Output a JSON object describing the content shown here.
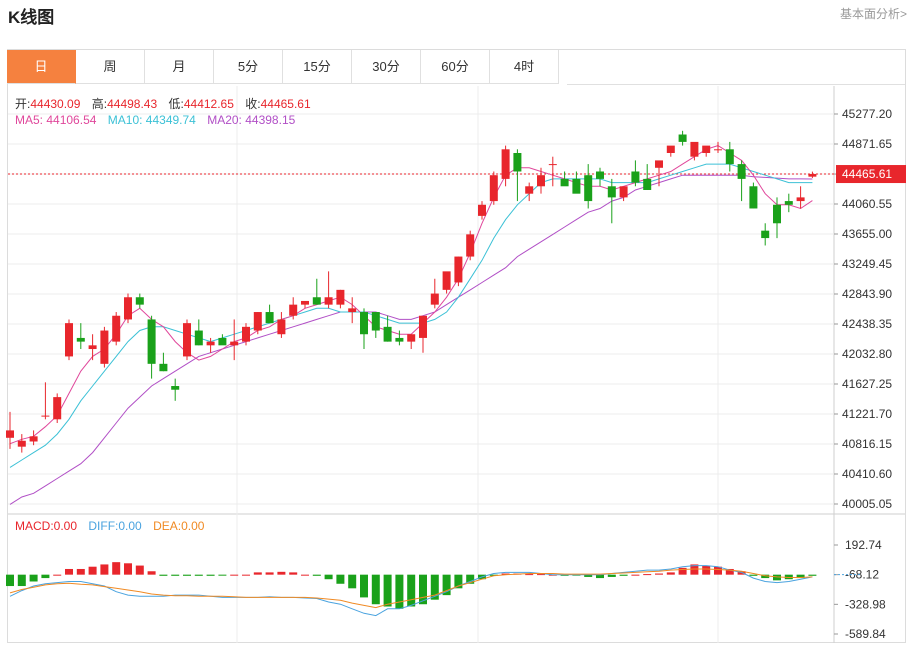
{
  "title": "K线图",
  "fundamental_link": "基本面分析>",
  "tabs": [
    {
      "label": "日",
      "active": true
    },
    {
      "label": "周",
      "active": false
    },
    {
      "label": "月",
      "active": false
    },
    {
      "label": "5分",
      "active": false
    },
    {
      "label": "15分",
      "active": false
    },
    {
      "label": "30分",
      "active": false
    },
    {
      "label": "60分",
      "active": false
    },
    {
      "label": "4时",
      "active": false
    }
  ],
  "ohlc_info": {
    "open_label": "开:",
    "open": "44430.09",
    "high_label": "高:",
    "high": "44498.43",
    "low_label": "低:",
    "low": "44412.65",
    "close_label": "收:",
    "close": "44465.61"
  },
  "ma_info": {
    "ma5_label": "MA5:",
    "ma5": "44106.54",
    "ma10_label": "MA10:",
    "ma10": "44349.74",
    "ma20_label": "MA20:",
    "ma20": "44398.15"
  },
  "macd_info": {
    "macd_label": "MACD:",
    "macd": "0.00",
    "diff_label": "DIFF:",
    "diff": "0.00",
    "dea_label": "DEA:",
    "dea": "0.00"
  },
  "colors": {
    "up": "#e8262c",
    "down": "#1aa11a",
    "ma5": "#e0479b",
    "ma10": "#3cc1d6",
    "ma20": "#b14fc6",
    "diff": "#4aa3df",
    "dea": "#f08a24",
    "price_line": "#e8262c",
    "tab_active": "#f5813f"
  },
  "chart_data": [
    {
      "type": "candlestick",
      "price_axis_ticks": [
        "45277.20",
        "44871.65",
        "44465.61",
        "44060.55",
        "43655.00",
        "43249.45",
        "42843.90",
        "42438.35",
        "42032.80",
        "41627.25",
        "41221.70",
        "40816.15",
        "40410.60",
        "40005.05"
      ],
      "current_price": "44465.61",
      "ylim": [
        40005.05,
        45277.2
      ],
      "candles": [
        [
          40900,
          41250,
          40750,
          41000
        ],
        [
          40780,
          40950,
          40700,
          40860
        ],
        [
          40850,
          41000,
          40800,
          40920
        ],
        [
          41200,
          41650,
          41150,
          41200
        ],
        [
          41150,
          41500,
          41100,
          41450
        ],
        [
          42000,
          42500,
          41950,
          42450
        ],
        [
          42250,
          42450,
          42100,
          42200
        ],
        [
          42100,
          42300,
          41950,
          42150
        ],
        [
          41900,
          42400,
          41850,
          42350
        ],
        [
          42200,
          42600,
          42150,
          42550
        ],
        [
          42500,
          42850,
          42450,
          42800
        ],
        [
          42800,
          42850,
          42650,
          42700
        ],
        [
          42500,
          42550,
          41700,
          41900
        ],
        [
          41900,
          42050,
          41800,
          41800
        ],
        [
          41600,
          41700,
          41400,
          41550
        ],
        [
          42000,
          42500,
          41950,
          42450
        ],
        [
          42350,
          42500,
          42150,
          42150
        ],
        [
          42150,
          42250,
          42050,
          42200
        ],
        [
          42250,
          42300,
          42200,
          42150
        ],
        [
          42150,
          42500,
          41950,
          42200
        ],
        [
          42200,
          42450,
          42150,
          42400
        ],
        [
          42350,
          42600,
          42300,
          42600
        ],
        [
          42600,
          42700,
          42450,
          42450
        ],
        [
          42300,
          42600,
          42250,
          42500
        ],
        [
          42550,
          42800,
          42500,
          42700
        ],
        [
          42700,
          42750,
          42650,
          42750
        ],
        [
          42800,
          43050,
          42700,
          42700
        ],
        [
          42700,
          43150,
          42650,
          42800
        ],
        [
          42700,
          42900,
          42650,
          42900
        ],
        [
          42600,
          42800,
          42450,
          42650
        ],
        [
          42600,
          42650,
          42100,
          42300
        ],
        [
          42600,
          42600,
          42250,
          42350
        ],
        [
          42400,
          42550,
          42200,
          42200
        ],
        [
          42250,
          42350,
          42150,
          42200
        ],
        [
          42200,
          42300,
          42100,
          42300
        ],
        [
          42250,
          42500,
          42050,
          42550
        ],
        [
          42700,
          43050,
          42650,
          42850
        ],
        [
          42900,
          43100,
          42850,
          43150
        ],
        [
          43000,
          43350,
          42950,
          43350
        ],
        [
          43350,
          43700,
          43300,
          43650
        ],
        [
          43900,
          44100,
          43850,
          44050
        ],
        [
          44100,
          44500,
          44050,
          44450
        ],
        [
          44400,
          44850,
          44300,
          44800
        ],
        [
          44750,
          44800,
          44100,
          44500
        ],
        [
          44200,
          44350,
          44100,
          44300
        ],
        [
          44300,
          44550,
          44200,
          44450
        ],
        [
          44600,
          44700,
          44300,
          44600
        ],
        [
          44400,
          44500,
          44350,
          44300
        ],
        [
          44400,
          44500,
          44250,
          44200
        ],
        [
          44450,
          44600,
          44000,
          44100
        ],
        [
          44500,
          44550,
          44300,
          44400
        ],
        [
          44300,
          44400,
          43800,
          44150
        ],
        [
          44150,
          44200,
          44100,
          44300
        ],
        [
          44500,
          44650,
          44300,
          44350
        ],
        [
          44400,
          44600,
          44250,
          44250
        ],
        [
          44550,
          44600,
          44300,
          44650
        ],
        [
          44750,
          44800,
          44700,
          44850
        ],
        [
          45000,
          45050,
          44850,
          44900
        ],
        [
          44700,
          44750,
          44650,
          44900
        ],
        [
          44750,
          44800,
          44700,
          44850
        ],
        [
          44800,
          44900,
          44750,
          44800
        ],
        [
          44800,
          44900,
          44500,
          44600
        ],
        [
          44600,
          44650,
          44100,
          44400
        ],
        [
          44300,
          44350,
          44000,
          44000
        ],
        [
          43700,
          43800,
          43500,
          43600
        ],
        [
          44050,
          44150,
          43600,
          43800
        ],
        [
          44100,
          44200,
          43950,
          44050
        ],
        [
          44100,
          44300,
          44000,
          44150
        ],
        [
          44430.09,
          44498.43,
          44412.65,
          44465.61
        ]
      ],
      "ma5": [
        40820,
        40880,
        40920,
        41050,
        41200,
        41500,
        41800,
        42000,
        42100,
        42300,
        42550,
        42650,
        42500,
        42400,
        42200,
        42050,
        41950,
        42000,
        42100,
        42200,
        42250,
        42350,
        42400,
        42500,
        42550,
        42650,
        42700,
        42750,
        42800,
        42700,
        42550,
        42400,
        42350,
        42300,
        42300,
        42450,
        42600,
        42800,
        43050,
        43400,
        43800,
        44150,
        44450,
        44550,
        44550,
        44500,
        44450,
        44400,
        44350,
        44300,
        44300,
        44250,
        44300,
        44350,
        44400,
        44450,
        44500,
        44600,
        44700,
        44800,
        44850,
        44750,
        44650,
        44450,
        44200,
        44050,
        44050,
        44000,
        44106.54
      ],
      "ma10": [
        40500,
        40600,
        40700,
        40800,
        40950,
        41150,
        41400,
        41600,
        41800,
        42000,
        42200,
        42350,
        42400,
        42400,
        42350,
        42300,
        42250,
        42200,
        42250,
        42300,
        42350,
        42400,
        42450,
        42500,
        42550,
        42600,
        42650,
        42650,
        42600,
        42600,
        42600,
        42550,
        42500,
        42450,
        42450,
        42450,
        42500,
        42600,
        42800,
        43050,
        43300,
        43600,
        43850,
        44050,
        44200,
        44350,
        44400,
        44400,
        44400,
        44400,
        44400,
        44350,
        44350,
        44350,
        44350,
        44400,
        44450,
        44500,
        44550,
        44600,
        44600,
        44600,
        44550,
        44500,
        44450,
        44400,
        44350,
        44350,
        44349.74
      ],
      "ma20": [
        40000,
        40100,
        40150,
        40250,
        40350,
        40450,
        40550,
        40700,
        40900,
        41100,
        41300,
        41450,
        41600,
        41700,
        41800,
        41900,
        42000,
        42050,
        42100,
        42150,
        42200,
        42250,
        42300,
        42350,
        42400,
        42450,
        42500,
        42550,
        42600,
        42600,
        42600,
        42600,
        42550,
        42500,
        42500,
        42550,
        42600,
        42700,
        42800,
        42900,
        43000,
        43100,
        43200,
        43350,
        43450,
        43550,
        43650,
        43750,
        43850,
        43950,
        44000,
        44100,
        44150,
        44250,
        44300,
        44350,
        44400,
        44450,
        44450,
        44450,
        44450,
        44450,
        44450,
        44430,
        44420,
        44410,
        44400,
        44400,
        44398.15
      ]
    },
    {
      "type": "bar",
      "name": "MACD",
      "axis_ticks": [
        "192.74",
        "-68.12",
        "-328.98",
        "-589.84"
      ],
      "ylim": [
        -589.84,
        192.74
      ],
      "values": [
        -100,
        -100,
        -60,
        -30,
        0,
        50,
        50,
        70,
        90,
        110,
        100,
        80,
        30,
        -10,
        -10,
        -10,
        -10,
        -10,
        -5,
        0,
        0,
        20,
        20,
        25,
        20,
        0,
        -10,
        -40,
        -80,
        -120,
        -200,
        -260,
        -280,
        -300,
        -280,
        -260,
        -220,
        -180,
        -120,
        -80,
        -40,
        -10,
        10,
        10,
        5,
        5,
        0,
        -10,
        -5,
        -20,
        -30,
        -20,
        -10,
        0,
        5,
        10,
        20,
        60,
        90,
        80,
        70,
        50,
        30,
        -10,
        -30,
        -50,
        -40,
        -30,
        -10
      ],
      "diff": [
        -190,
        -140,
        -100,
        -80,
        -70,
        -60,
        -60,
        -80,
        -100,
        -150,
        -180,
        -190,
        -190,
        -190,
        -180,
        -180,
        -180,
        -190,
        -200,
        -200,
        -200,
        -200,
        -195,
        -200,
        -200,
        -205,
        -210,
        -240,
        -260,
        -300,
        -340,
        -360,
        -300,
        -300,
        -270,
        -230,
        -190,
        -150,
        -100,
        -60,
        -20,
        10,
        20,
        20,
        20,
        10,
        0,
        0,
        0,
        0,
        0,
        10,
        20,
        30,
        40,
        40,
        50,
        70,
        80,
        80,
        70,
        40,
        20,
        -30,
        -60,
        -70,
        -60,
        -40,
        -20
      ],
      "dea": [
        -160,
        -130,
        -110,
        -90,
        -80,
        -75,
        -85,
        -90,
        -105,
        -120,
        -135,
        -150,
        -170,
        -180,
        -185,
        -185,
        -190,
        -190,
        -190,
        -195,
        -200,
        -200,
        -200,
        -200,
        -200,
        -200,
        -205,
        -215,
        -225,
        -250,
        -270,
        -290,
        -260,
        -240,
        -220,
        -200,
        -180,
        -140,
        -100,
        -70,
        -40,
        -10,
        0,
        5,
        10,
        10,
        10,
        5,
        5,
        5,
        5,
        10,
        15,
        20,
        25,
        30,
        40,
        45,
        50,
        50,
        45,
        40,
        30,
        10,
        -10,
        -20,
        -25,
        -25,
        -20
      ]
    }
  ]
}
